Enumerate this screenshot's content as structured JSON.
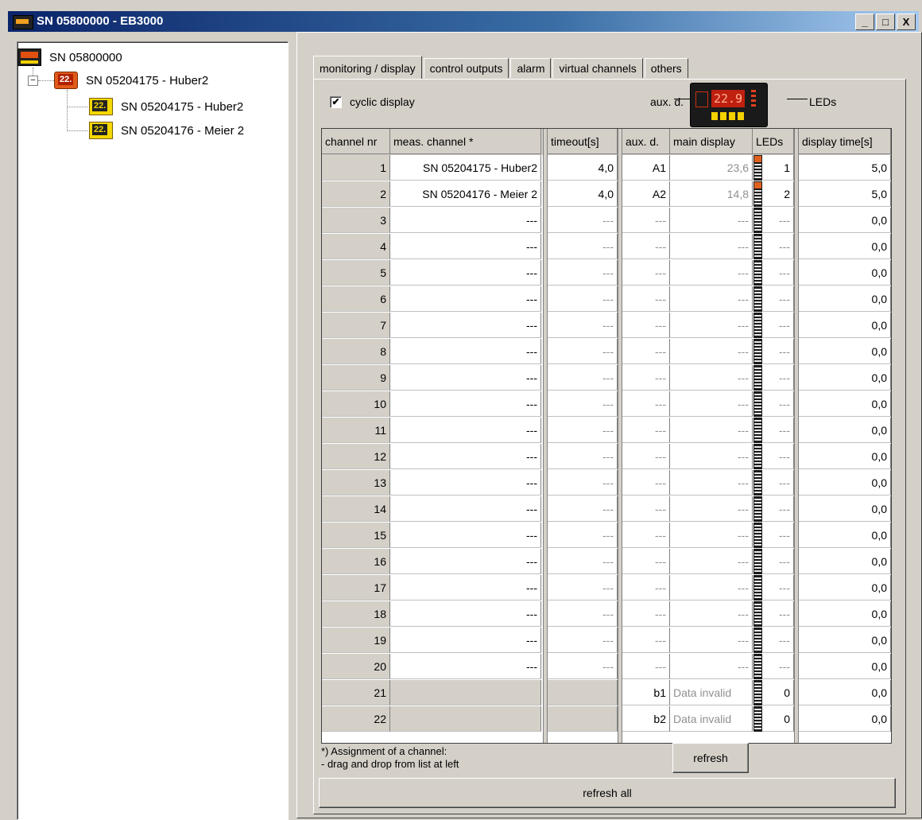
{
  "window": {
    "title": "SN 05800000 - EB3000",
    "buttons": {
      "minimize": "_",
      "maximize": "□",
      "close": "X"
    }
  },
  "tree": {
    "root": "SN 05800000",
    "group": "SN 05204175 - Huber2",
    "children": [
      "SN 05204175 - Huber2",
      "SN 05204176 - Meier 2"
    ]
  },
  "tabs": [
    "monitoring / display",
    "control outputs",
    "alarm",
    "virtual channels",
    "others"
  ],
  "monitoring": {
    "cyclic_display_label": "cyclic display",
    "cyclic_display_checked": "✔",
    "aux_label": "aux. d.",
    "leds_label": "LEDs",
    "device_readout": "22.9"
  },
  "table": {
    "headers": [
      "channel nr",
      "meas. channel *",
      "timeout[s]",
      "aux. d.",
      "main display",
      "LEDs",
      "display time[s]"
    ],
    "rows": [
      {
        "nr": "1",
        "channel": "SN 05204175 - Huber2",
        "timeout": "4,0",
        "aux": "A1",
        "main": "23,6",
        "leds": "1",
        "time": "5,0"
      },
      {
        "nr": "2",
        "channel": "SN 05204176 - Meier 2",
        "timeout": "4,0",
        "aux": "A2",
        "main": "14,8",
        "leds": "2",
        "time": "5,0"
      },
      {
        "nr": "3",
        "channel": "---",
        "timeout": "---",
        "aux": "---",
        "main": "---",
        "leds": "---",
        "time": "0,0"
      },
      {
        "nr": "4",
        "channel": "---",
        "timeout": "---",
        "aux": "---",
        "main": "---",
        "leds": "---",
        "time": "0,0"
      },
      {
        "nr": "5",
        "channel": "---",
        "timeout": "---",
        "aux": "---",
        "main": "---",
        "leds": "---",
        "time": "0,0"
      },
      {
        "nr": "6",
        "channel": "---",
        "timeout": "---",
        "aux": "---",
        "main": "---",
        "leds": "---",
        "time": "0,0"
      },
      {
        "nr": "7",
        "channel": "---",
        "timeout": "---",
        "aux": "---",
        "main": "---",
        "leds": "---",
        "time": "0,0"
      },
      {
        "nr": "8",
        "channel": "---",
        "timeout": "---",
        "aux": "---",
        "main": "---",
        "leds": "---",
        "time": "0,0"
      },
      {
        "nr": "9",
        "channel": "---",
        "timeout": "---",
        "aux": "---",
        "main": "---",
        "leds": "---",
        "time": "0,0"
      },
      {
        "nr": "10",
        "channel": "---",
        "timeout": "---",
        "aux": "---",
        "main": "---",
        "leds": "---",
        "time": "0,0"
      },
      {
        "nr": "11",
        "channel": "---",
        "timeout": "---",
        "aux": "---",
        "main": "---",
        "leds": "---",
        "time": "0,0"
      },
      {
        "nr": "12",
        "channel": "---",
        "timeout": "---",
        "aux": "---",
        "main": "---",
        "leds": "---",
        "time": "0,0"
      },
      {
        "nr": "13",
        "channel": "---",
        "timeout": "---",
        "aux": "---",
        "main": "---",
        "leds": "---",
        "time": "0,0"
      },
      {
        "nr": "14",
        "channel": "---",
        "timeout": "---",
        "aux": "---",
        "main": "---",
        "leds": "---",
        "time": "0,0"
      },
      {
        "nr": "15",
        "channel": "---",
        "timeout": "---",
        "aux": "---",
        "main": "---",
        "leds": "---",
        "time": "0,0"
      },
      {
        "nr": "16",
        "channel": "---",
        "timeout": "---",
        "aux": "---",
        "main": "---",
        "leds": "---",
        "time": "0,0"
      },
      {
        "nr": "17",
        "channel": "---",
        "timeout": "---",
        "aux": "---",
        "main": "---",
        "leds": "---",
        "time": "0,0"
      },
      {
        "nr": "18",
        "channel": "---",
        "timeout": "---",
        "aux": "---",
        "main": "---",
        "leds": "---",
        "time": "0,0"
      },
      {
        "nr": "19",
        "channel": "---",
        "timeout": "---",
        "aux": "---",
        "main": "---",
        "leds": "---",
        "time": "0,0"
      },
      {
        "nr": "20",
        "channel": "---",
        "timeout": "---",
        "aux": "---",
        "main": "---",
        "leds": "---",
        "time": "0,0"
      },
      {
        "nr": "21",
        "channel": "",
        "timeout": "",
        "aux": "b1",
        "main": "Data invalid",
        "leds": "0",
        "time": "0,0"
      },
      {
        "nr": "22",
        "channel": "",
        "timeout": "",
        "aux": "b2",
        "main": "Data invalid",
        "leds": "0",
        "time": "0,0"
      }
    ]
  },
  "footer": {
    "note_line1": "*) Assignment of a channel:",
    "note_line2": "- drag and drop from list at left",
    "refresh_label": "refresh",
    "refresh_all_label": "refresh all"
  }
}
